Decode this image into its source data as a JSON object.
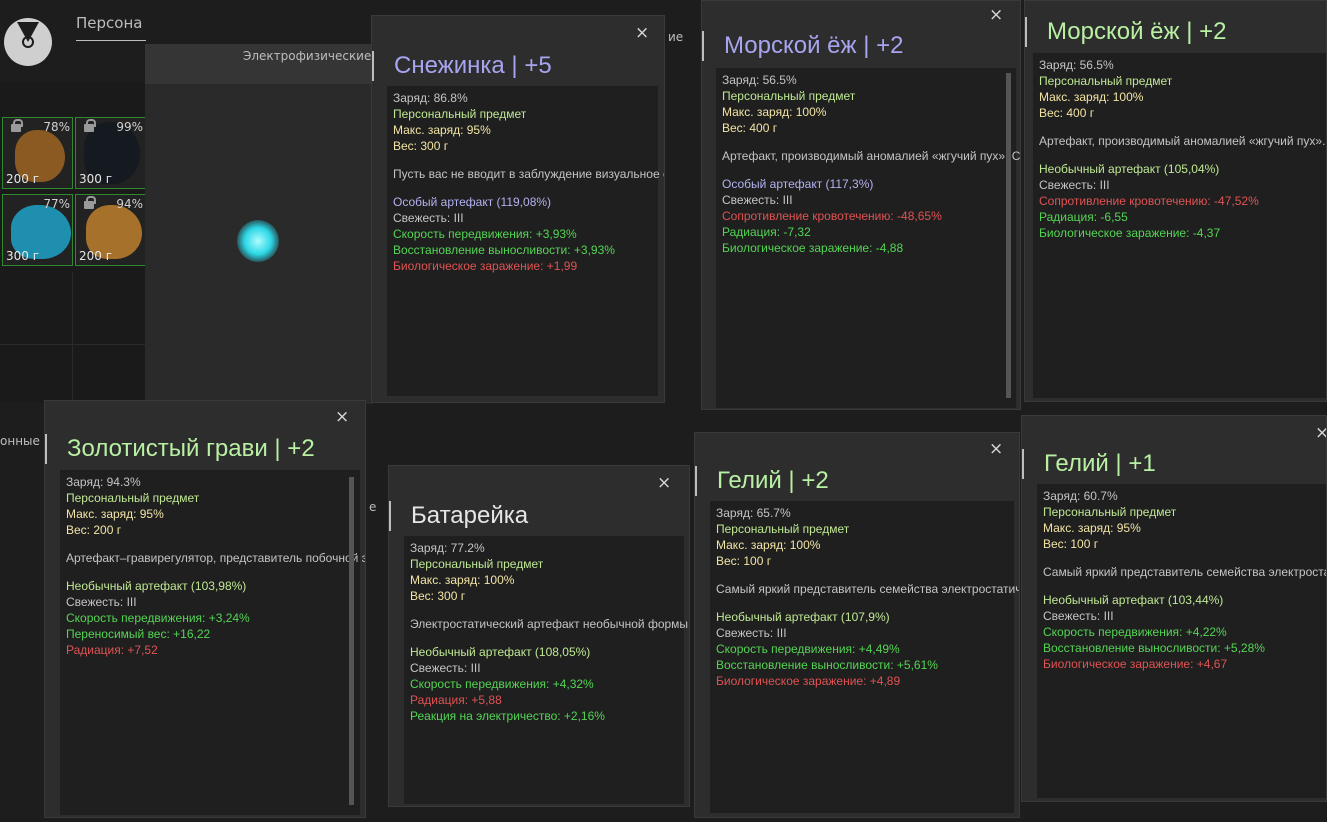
{
  "background": {
    "tab_personal": "Персона",
    "tab_electrophysical": "Электрофизические",
    "tab_behind_1": "ие",
    "tab_behind_2": "онные",
    "tab_behind_3": "е"
  },
  "inventory": [
    {
      "percent": "78%",
      "weight": "200 г",
      "locked": true,
      "color": "#8a5a22"
    },
    {
      "percent": "99%",
      "weight": "300 г",
      "locked": true,
      "color": "#141a1f"
    },
    {
      "percent": "77%",
      "weight": "300 г",
      "locked": false,
      "color": "#1f8fb0"
    },
    {
      "percent": "94%",
      "weight": "200 г",
      "locked": true,
      "color": "#a6712b"
    }
  ],
  "colors": {
    "card_bg": "#2d2d2d",
    "body_bg": "#1f1f1f",
    "green": "#54d454",
    "lime": "#bfe894",
    "yellow": "#f2e4a4",
    "purple": "#b3b2f0",
    "red": "#e05353",
    "title_purple": "#a7a5f0",
    "title_green": "#b9f0a4",
    "title_white": "#e6e6e6"
  },
  "cards": [
    {
      "title": "Снежинка | +5",
      "close": "×",
      "charge": "Заряд: 86.8%",
      "personal": "Персональный предмет",
      "max_charge": "Макс. заряд: 95%",
      "weight": "Вес: 300 г",
      "description": "Пусть вас не вводит в заблуждение визуальное сходство с «Колобком» – положительные свойства артефактов значительно различаются. Способен увеличивать скорость восстановления выносливости, но, как и предполагаемый родитель – «Колобок», токсичен.",
      "rarity": "Особый артефакт (119,08%)",
      "freshness": "Свежесть: III",
      "stats": [
        {
          "text": "Скорость передвижения: +3,93%",
          "tone": "green"
        },
        {
          "text": "Восстановление выносливости: +3,93%",
          "tone": "green"
        },
        {
          "text": "Биологическое заражение: +1,99",
          "tone": "red"
        }
      ]
    },
    {
      "title": "Морской ёж | +2",
      "close": "×",
      "charge": "Заряд: 56.5%",
      "personal": "Персональный предмет",
      "max_charge": "Макс. заряд: 100%",
      "weight": "Вес: 400 г",
      "description": "Артефакт, производимый аномалией «жгучий пух». Сфера серого цвета, покрыта не слишком острыми, но густыми колючками. На вес очень лёгкая. Ношение артефакта практически мгновенно избавляет организм от накопившейся в нём радиации и токсинов, но во время использования этого артефакта повышается вероятность возникновения спонтанных кровотечений из-за частых перепадов кровяного давления.",
      "rarity": "Особый артефакт (117,3%)",
      "freshness": "Свежесть: III",
      "stats": [
        {
          "text": "Сопротивление кровотечению: -48,65%",
          "tone": "red"
        },
        {
          "text": "Радиация: -7,32",
          "tone": "green"
        },
        {
          "text": "Биологическое заражение: -4,88",
          "tone": "green"
        }
      ]
    },
    {
      "title": "Морской ёж | +2",
      "charge": "Заряд: 56.5%",
      "personal": "Персональный предмет",
      "max_charge": "Макс. заряд: 100%",
      "weight": "Вес: 400 г",
      "description": "Артефакт, производимый аномалией «жгучий пух». Сфера серого цвета, покрыта не слишком острыми, но густыми колючками. На вес очень лёгкая. Ношение артефакта практически мгновенно избавляет организм от накопившейся в нём радиации и токсинов, но во время использования этого артефакта повышается вероятность возникновения спонтанных кровотечений из-за частых перепадов кровяного давления.",
      "rarity": "Необычный артефакт (105,04%)",
      "freshness": "Свежесть: III",
      "stats": [
        {
          "text": "Сопротивление кровотечению: -47,52%",
          "tone": "red"
        },
        {
          "text": "Радиация: -6,55",
          "tone": "green"
        },
        {
          "text": "Биологическое заражение: -4,37",
          "tone": "green"
        }
      ]
    },
    {
      "title": "Золотистый грави | +2",
      "close": "×",
      "charge": "Заряд: 94.3%",
      "personal": "Персональный предмет",
      "max_charge": "Макс. заряд: 95%",
      "weight": "Вес: 200 г",
      "description": "Артефакт–гравирегулятор, представитель побочной эволюционной ветки семейства «вывертов». Формируется в «воронке» параллельно с «золотой рыбкой», но технически совершенно по иному принципу. Создает устойчивое поле с отрицательной гравитацией, благодаря чему не только рюкзак носителя становится легче, но и он сам. Вследствие редкости, все свойства не изучены.",
      "rarity": "Необычный артефакт (103,98%)",
      "freshness": "Свежесть: III",
      "stats": [
        {
          "text": "Скорость передвижения: +3,24%",
          "tone": "green"
        },
        {
          "text": "Переносимый вес: +16,22",
          "tone": "green"
        },
        {
          "text": "Радиация: +7,52",
          "tone": "red"
        }
      ]
    },
    {
      "title": "Батарейка",
      "close": "×",
      "charge": "Заряд: 77.2%",
      "personal": "Персональный предмет",
      "max_charge": "Макс. заряд: 100%",
      "weight": "Вес: 300 г",
      "description": "Электростатический артефакт необычной формы. При контакте с током поглощает часть электронов, снижая силу тока. Радиоактивен.",
      "rarity": "Необычный артефакт (108,05%)",
      "freshness": "Свежесть: III",
      "stats": [
        {
          "text": "Скорость передвижения: +4,32%",
          "tone": "green"
        },
        {
          "text": "Радиация: +5,88",
          "tone": "red"
        },
        {
          "text": "Реакция на электричество: +2,16%",
          "tone": "green"
        }
      ]
    },
    {
      "title": "Гелий | +2",
      "close": "×",
      "charge": "Заряд: 65.7%",
      "personal": "Персональный предмет",
      "max_charge": "Макс. заряд: 100%",
      "weight": "Вес: 100 г",
      "description": "Самый яркий представитель семейства электростатических артефактов. Выделяет газообразное вещество, способное вызвать выброс адреналина в кровь человека, но ухудшающее общее состояние, если его не нейтрализовать. Ввиду большой эффективности пользуется высоким спросом.",
      "rarity": "Необычный артефакт (107,9%)",
      "freshness": "Свежесть: III",
      "stats": [
        {
          "text": "Скорость передвижения: +4,49%",
          "tone": "green"
        },
        {
          "text": "Восстановление выносливости: +5,61%",
          "tone": "green"
        },
        {
          "text": "Биологическое заражение: +4,89",
          "tone": "red"
        }
      ]
    },
    {
      "title": "Гелий | +1",
      "close": "×",
      "charge": "Заряд: 60.7%",
      "personal": "Персональный предмет",
      "max_charge": "Макс. заряд: 95%",
      "weight": "Вес: 100 г",
      "description": "Самый яркий представитель семейства электростатических артефактов. Выделяет газообразное вещество, способное вызвать выброс адреналина в кровь человека, но ухудшающее общее состояние, если его не нейтрализовать. Ввиду большой эффективности пользуется высоким спросом.",
      "rarity": "Необычный артефакт (103,44%)",
      "freshness": "Свежесть: III",
      "stats": [
        {
          "text": "Скорость передвижения: +4,22%",
          "tone": "green"
        },
        {
          "text": "Восстановление выносливости: +5,28%",
          "tone": "green"
        },
        {
          "text": "Биологическое заражение: +4,67",
          "tone": "red"
        }
      ]
    }
  ]
}
